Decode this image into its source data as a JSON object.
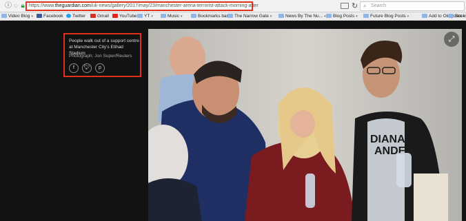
{
  "browser": {
    "url_prefix": "https://www.",
    "url_domain": "theguardian.com",
    "url_path": "/uk-news/gallery/2017/may/23/manchester-arena-terrorist-attack-morning-after",
    "search_placeholder": "Search",
    "icons": {
      "back": "info-icon",
      "lock": "lock-icon",
      "reader": "reader-view-icon",
      "reload": "reload-icon",
      "search": "search-icon"
    }
  },
  "bookmarks": [
    {
      "label": "Video Blog",
      "icon": "folder",
      "caret": true
    },
    {
      "label": "Facebook",
      "icon": "fb",
      "caret": false
    },
    {
      "label": "Twitter",
      "icon": "tw",
      "caret": false
    },
    {
      "label": "Gmail",
      "icon": "gm",
      "caret": false
    },
    {
      "label": "YouTube",
      "icon": "yt",
      "caret": false
    },
    {
      "label": "YT",
      "icon": "folder",
      "caret": true
    },
    {
      "label": "Music",
      "icon": "folder",
      "caret": true
    },
    {
      "label": "Bookmarks bar",
      "icon": "folder",
      "caret": true
    },
    {
      "label": "The Narrow Gate",
      "icon": "folder",
      "caret": true
    },
    {
      "label": "News By The Nu...",
      "icon": "folder",
      "caret": true
    },
    {
      "label": "Blog Posts",
      "icon": "folder",
      "caret": true
    },
    {
      "label": "Future Blog Posts",
      "icon": "folder",
      "caret": true
    },
    {
      "label": "Add to Old posts",
      "icon": "folder",
      "caret": true
    },
    {
      "label": "Books",
      "icon": "folder",
      "caret": true
    }
  ],
  "caption": {
    "text": "People walk out of a support centre at Manchester City's Etihad Stadium",
    "credit": "Photograph: Jon Super/Reuters",
    "share": [
      {
        "name": "facebook-share-icon",
        "glyph": "f"
      },
      {
        "name": "twitter-share-icon",
        "glyph": "🐦"
      },
      {
        "name": "pinterest-share-icon",
        "glyph": "p"
      }
    ]
  },
  "photo": {
    "expand_icon": "expand-icon",
    "shirt_text": "DIANA\nANDE"
  },
  "colors": {
    "highlight": "#e0301e",
    "page_bg": "#121212"
  }
}
